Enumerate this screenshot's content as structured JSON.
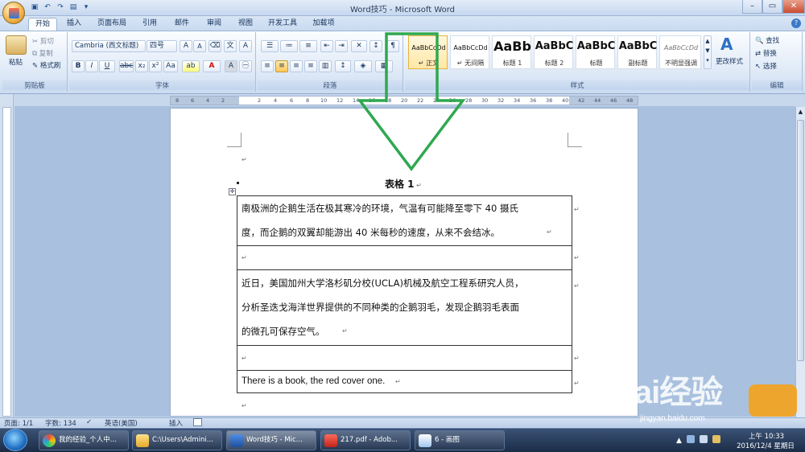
{
  "window": {
    "title": "Word技巧 - Microsoft Word"
  },
  "tabs": [
    "开始",
    "插入",
    "页面布局",
    "引用",
    "邮件",
    "审阅",
    "视图",
    "开发工具",
    "加载项"
  ],
  "clipboard": {
    "paste": "粘贴",
    "cut": "剪切",
    "copy": "复制",
    "format_painter": "格式刷",
    "group": "剪贴板"
  },
  "font": {
    "name": "Cambria (西文标题)",
    "size": "四号",
    "group": "字体"
  },
  "paragraph": {
    "group": "段落"
  },
  "styles": {
    "group": "样式",
    "items": [
      {
        "preview": "AaBbCcDd",
        "name": "↵ 正文"
      },
      {
        "preview": "AaBbCcDd",
        "name": "↵ 无间隔"
      },
      {
        "preview": "AaBb",
        "name": "标题 1"
      },
      {
        "preview": "AaBbC",
        "name": "标题 2"
      },
      {
        "preview": "AaBbC",
        "name": "标题"
      },
      {
        "preview": "AaBbC",
        "name": "副标题"
      },
      {
        "preview": "AaBbCcDd",
        "name": "不明显强调"
      }
    ],
    "change_styles": "更改样式"
  },
  "editing": {
    "find": "查找",
    "replace": "替换",
    "select": "选择",
    "group": "编辑"
  },
  "document": {
    "caption": "表格 1",
    "rows": [
      [
        "南极洲的企鹅生活在极其寒冷的环境，气温有可能降至零下 40 摄氏",
        "度，而企鹅的双翼却能游出 40 米每秒的速度，从来不会结冰。"
      ],
      [
        ""
      ],
      [
        "近日，美国加州大学洛杉矶分校(UCLA)机械及航空工程系研究人员，",
        "分析圣迭戈海洋世界提供的不同种类的企鹅羽毛，发现企鹅羽毛表面",
        "的微孔可保存空气。"
      ],
      [
        ""
      ],
      [
        "There is a book, the red cover one."
      ]
    ]
  },
  "status": {
    "page": "页面: 1/1",
    "words": "字数: 134",
    "language": "英语(美国)",
    "mode": "插入"
  },
  "taskbar": {
    "items": [
      "我的经验_个人中...",
      "C:\\Users\\Admini...",
      "Word技巧 - Mic...",
      "217.pdf - Adob...",
      "6 - 画图"
    ],
    "time": "上午 10:33",
    "date": "2016/12/4 星期日"
  },
  "watermark": {
    "text": "Bai经验",
    "url": "jingyan.baidu.com"
  },
  "colors": {
    "annotation_arrow": "#2fa84f",
    "accent": "#1f4f8f"
  }
}
